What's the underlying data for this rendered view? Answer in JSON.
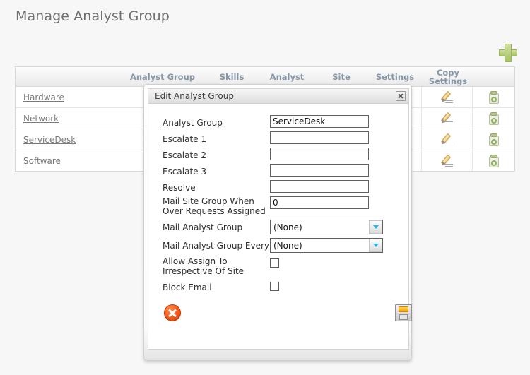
{
  "page": {
    "title": "Manage Analyst Group",
    "add_button_icon": "plus-icon"
  },
  "grid": {
    "columns": [
      {
        "key": "analyst_group",
        "label": "Analyst Group"
      },
      {
        "key": "skills",
        "label": "Skills"
      },
      {
        "key": "analyst",
        "label": "Analyst"
      },
      {
        "key": "site",
        "label": "Site"
      },
      {
        "key": "settings",
        "label": "Settings"
      },
      {
        "key": "copy_settings",
        "label": "Copy Settings"
      }
    ],
    "rows": [
      {
        "name": "Hardware",
        "edit_icon": "pencil-icon",
        "copy_icon": "clipboard-icon"
      },
      {
        "name": "Network",
        "edit_icon": "pencil-icon",
        "copy_icon": "clipboard-icon"
      },
      {
        "name": "ServiceDesk",
        "edit_icon": "pencil-icon",
        "copy_icon": "clipboard-icon"
      },
      {
        "name": "Software",
        "edit_icon": "pencil-icon",
        "copy_icon": "clipboard-icon"
      }
    ]
  },
  "dialog": {
    "title": "Edit Analyst Group",
    "close_icon": "close-icon",
    "fields": {
      "analyst_group": {
        "label": "Analyst Group",
        "value": "ServiceDesk",
        "placeholder": ""
      },
      "escalate1": {
        "label": "Escalate 1",
        "value": "",
        "placeholder": ""
      },
      "escalate2": {
        "label": "Escalate 2",
        "value": "",
        "placeholder": ""
      },
      "escalate3": {
        "label": "Escalate 3",
        "value": "",
        "placeholder": ""
      },
      "resolve": {
        "label": "Resolve",
        "value": "",
        "placeholder": ""
      },
      "mail_site_group": {
        "label_line1": "Mail Site Group When",
        "label_line2": "Over Requests Assigned",
        "value": "0",
        "placeholder": ""
      },
      "mail_analyst_group": {
        "label": "Mail Analyst Group",
        "value": "(None)"
      },
      "mail_analyst_group_every": {
        "label": "Mail Analyst Group Every",
        "value": "(None)"
      },
      "allow_assign": {
        "label_line1": "Allow Assign To",
        "label_line2": "Irrespective Of Site",
        "checked": false
      },
      "block_email": {
        "label": "Block Email",
        "checked": false
      }
    },
    "actions": {
      "cancel_icon": "cancel-circle-icon",
      "save_icon": "floppy-save-icon"
    }
  },
  "colors": {
    "page_background": "#f7f7f7",
    "title_text": "#6f6f6f",
    "grid_header_text": "#8796a8",
    "link_text": "#7a7a7a",
    "add_button_green": "#b5cd7a",
    "dropdown_arrow_blue": "#18b4ef",
    "cancel_red": "#f4591a",
    "save_yellow": "#f5a300"
  }
}
